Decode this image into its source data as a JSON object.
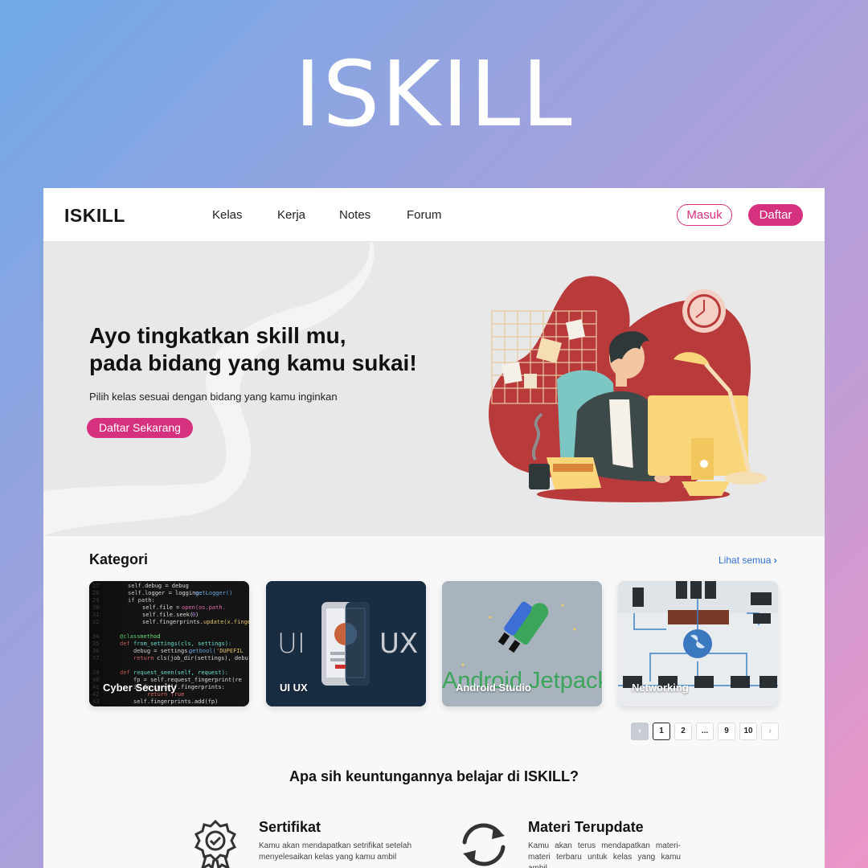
{
  "page_title": "ISKILL",
  "nav": {
    "logo": "ISKILL",
    "links": [
      "Kelas",
      "Kerja",
      "Notes",
      "Forum"
    ],
    "login_label": "Masuk",
    "register_label": "Daftar"
  },
  "hero": {
    "heading_line1": "Ayo tingkatkan skill mu,",
    "heading_line2": "pada bidang yang kamu sukai!",
    "subtitle": "Pilih kelas sesuai dengan bidang yang kamu inginkan",
    "cta": "Daftar Sekarang"
  },
  "kategori": {
    "title": "Kategori",
    "see_all": "Lihat semua",
    "cards": [
      {
        "label": "Cyber Security"
      },
      {
        "label": "UI UX",
        "art_left": "UI",
        "art_right": "UX"
      },
      {
        "label": "Android Studio",
        "art_text": "Android Jetpack"
      },
      {
        "label": "Networking"
      }
    ]
  },
  "pagination": {
    "pages": [
      "1",
      "2",
      "...",
      "9",
      "10"
    ],
    "current": "1"
  },
  "benefits": {
    "title": "Apa sih keuntungannya belajar di ISKILL?",
    "items": [
      {
        "title": "Sertifikat",
        "text": "Kamu akan mendapatkan setrifikat setelah menyelesaikan kelas yang kamu ambil",
        "icon": "certificate-icon"
      },
      {
        "title": "Materi Terupdate",
        "text": "Kamu akan terus mendapatkan materi-materi terbaru untuk kelas yang kamu ambil",
        "icon": "refresh-icon"
      }
    ]
  },
  "colors": {
    "accent": "#d6317f",
    "link": "#2f6fcf",
    "illustration_red": "#b83a3a"
  }
}
